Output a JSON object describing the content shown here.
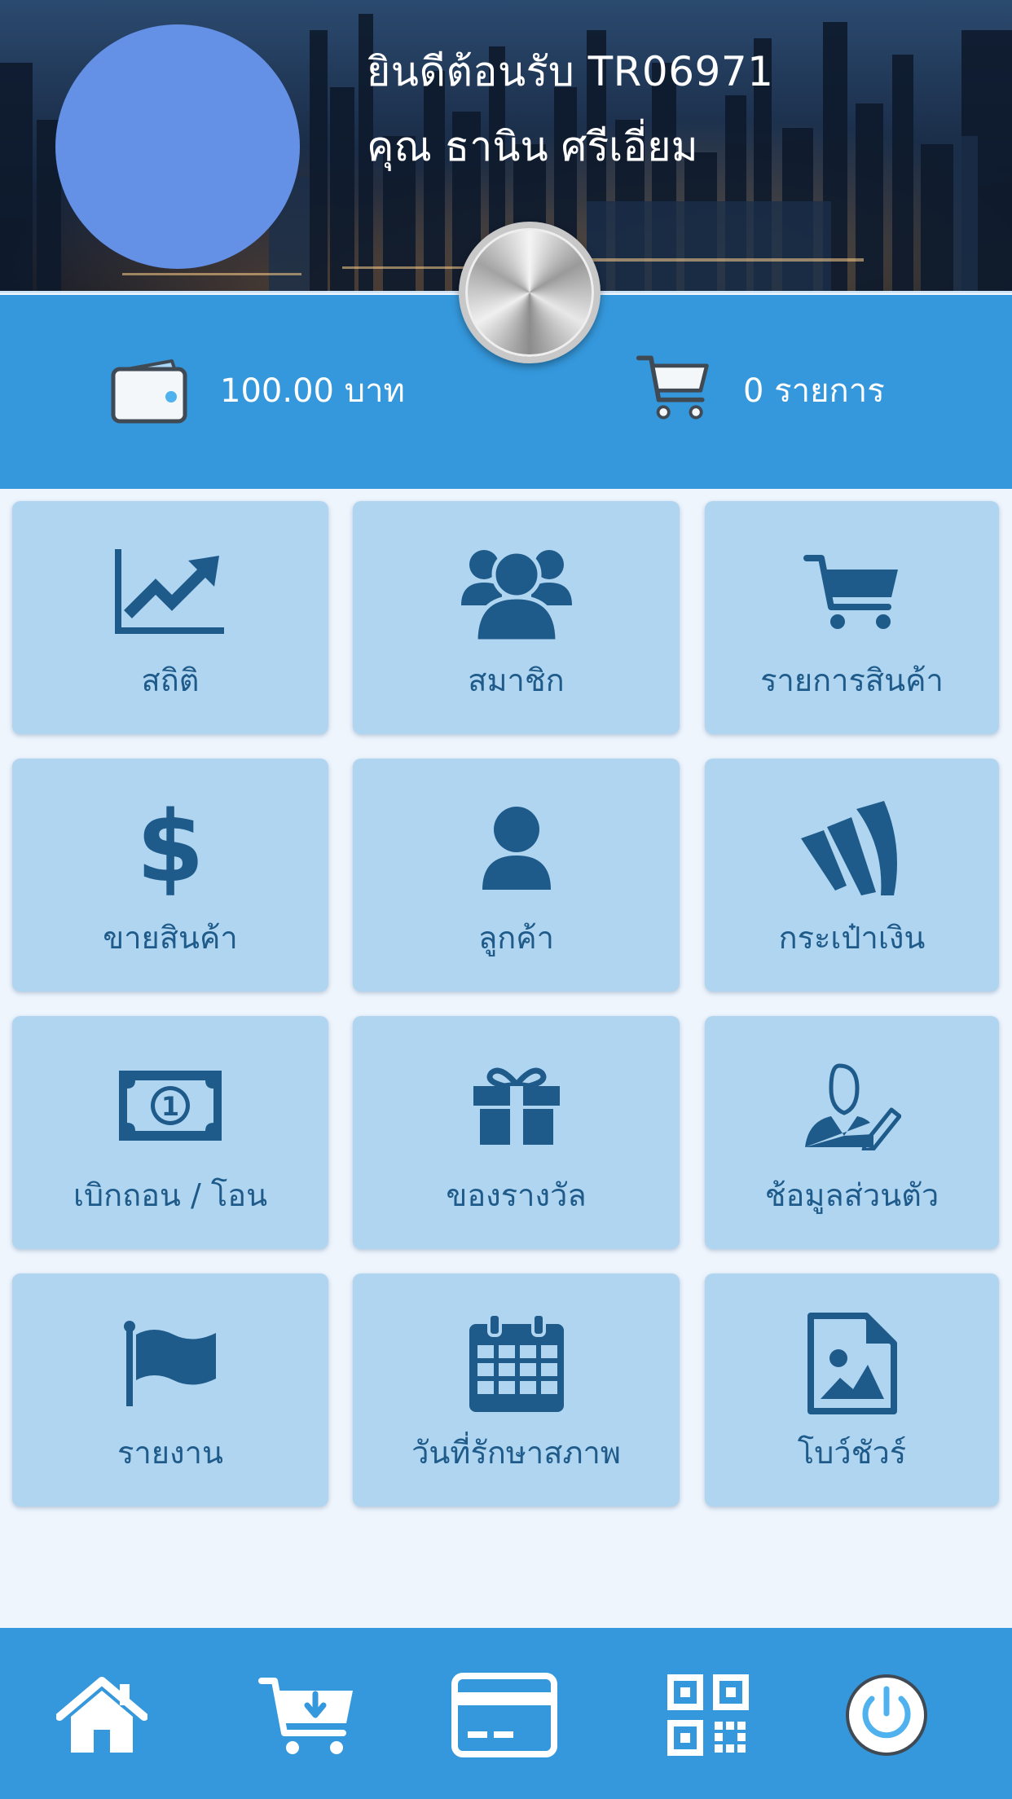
{
  "header": {
    "welcome": "ยินดีต้อนรับ TR06971",
    "name": "คุณ ธานิน ศรีเอี่ยม"
  },
  "stats": {
    "balance": "100.00 บาท",
    "cart": "0 รายการ"
  },
  "menu": [
    {
      "label": "สถิติ",
      "icon": "chart-icon"
    },
    {
      "label": "สมาชิก",
      "icon": "users-icon"
    },
    {
      "label": "รายการสินค้า",
      "icon": "cart-icon"
    },
    {
      "label": "ขายสินค้า",
      "icon": "dollar-icon"
    },
    {
      "label": "ลูกค้า",
      "icon": "user-icon"
    },
    {
      "label": "กระเป๋าเงิน",
      "icon": "wallet-stripes-icon"
    },
    {
      "label": "เบิกถอน / โอน",
      "icon": "banknote-icon"
    },
    {
      "label": "ของรางวัล",
      "icon": "gift-icon"
    },
    {
      "label": "ช้อมูลส่วนตัว",
      "icon": "profile-edit-icon"
    },
    {
      "label": "รายงาน",
      "icon": "flag-icon"
    },
    {
      "label": "วันที่รักษาสภาพ",
      "icon": "calendar-icon"
    },
    {
      "label": "โบว์ชัวร์",
      "icon": "image-file-icon"
    }
  ],
  "bottom_nav": [
    "home-icon",
    "cart-download-icon",
    "credit-card-icon",
    "qr-code-icon",
    "power-icon"
  ],
  "colors": {
    "primary": "#3598dc",
    "tile": "#b0d5f0",
    "icon": "#1f5b8a",
    "background": "#eef5fd",
    "avatar": "#6490e6"
  }
}
